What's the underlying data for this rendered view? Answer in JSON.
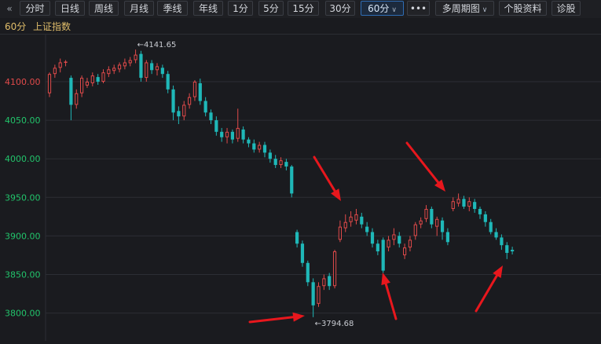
{
  "toolbar": {
    "back_icon": "double-chevron-left-icon",
    "buttons": [
      "分时",
      "日线",
      "周线",
      "月线",
      "季线",
      "年线",
      "1分",
      "5分",
      "15分",
      "30分",
      "60分",
      "•••",
      "多周期图",
      "个股资料",
      "诊股"
    ],
    "active": "60分"
  },
  "subheader": {
    "period": "60分",
    "index_name": "上证指数"
  },
  "colors": {
    "up": "#e04a4a",
    "down": "#1fb8b8",
    "grid": "#2c2e34",
    "axis_text_up": "#e04a4a",
    "axis_text_down": "#22c46b",
    "annotation_arrow": "#e8171d"
  },
  "chart_data": {
    "type": "candlestick",
    "ylim": [
      3780,
      4160
    ],
    "y_ticks": [
      3800,
      3850,
      3900,
      3950,
      4000,
      4050,
      4100
    ],
    "y_tick_labels": [
      "3800.00",
      "3850.00",
      "3900.00",
      "3950.00",
      "4000.00",
      "4050.00",
      "4100.00"
    ],
    "high_label": "4141.65",
    "low_label": "3794.68",
    "candles": [
      [
        4085,
        4110,
        4080,
        4112
      ],
      [
        4110,
        4118,
        4105,
        4122
      ],
      [
        4118,
        4125,
        4112,
        4130
      ],
      [
        4125,
        4126,
        4120,
        4128
      ],
      [
        4105,
        4070,
        4050,
        4108
      ],
      [
        4070,
        4085,
        4065,
        4090
      ],
      [
        4085,
        4105,
        4080,
        4108
      ],
      [
        4095,
        4100,
        4092,
        4105
      ],
      [
        4098,
        4108,
        4094,
        4112
      ],
      [
        4106,
        4100,
        4096,
        4110
      ],
      [
        4100,
        4112,
        4098,
        4116
      ],
      [
        4110,
        4116,
        4106,
        4120
      ],
      [
        4114,
        4118,
        4110,
        4122
      ],
      [
        4116,
        4122,
        4112,
        4125
      ],
      [
        4120,
        4125,
        4116,
        4130
      ],
      [
        4124,
        4128,
        4120,
        4132
      ],
      [
        4128,
        4135,
        4124,
        4141.65
      ],
      [
        4136,
        4105,
        4100,
        4140
      ],
      [
        4105,
        4125,
        4100,
        4128
      ],
      [
        4124,
        4115,
        4110,
        4128
      ],
      [
        4115,
        4120,
        4108,
        4124
      ],
      [
        4118,
        4110,
        4105,
        4122
      ],
      [
        4110,
        4090,
        4085,
        4114
      ],
      [
        4090,
        4060,
        4050,
        4095
      ],
      [
        4062,
        4055,
        4045,
        4068
      ],
      [
        4055,
        4070,
        4050,
        4075
      ],
      [
        4070,
        4080,
        4065,
        4085
      ],
      [
        4080,
        4100,
        4075,
        4102
      ],
      [
        4098,
        4075,
        4070,
        4104
      ],
      [
        4075,
        4060,
        4055,
        4080
      ],
      [
        4060,
        4050,
        4045,
        4064
      ],
      [
        4050,
        4035,
        4030,
        4055
      ],
      [
        4035,
        4028,
        4022,
        4040
      ],
      [
        4028,
        4035,
        4020,
        4040
      ],
      [
        4035,
        4025,
        4020,
        4038
      ],
      [
        4026,
        4040,
        4022,
        4065
      ],
      [
        4038,
        4025,
        4020,
        4042
      ],
      [
        4025,
        4020,
        4015,
        4028
      ],
      [
        4020,
        4012,
        4008,
        4025
      ],
      [
        4012,
        4018,
        4008,
        4022
      ],
      [
        4018,
        4008,
        4002,
        4022
      ],
      [
        4008,
        4000,
        3995,
        4012
      ],
      [
        4000,
        3992,
        3988,
        4005
      ],
      [
        3992,
        3998,
        3988,
        4002
      ],
      [
        3996,
        3990,
        3985,
        4000
      ],
      [
        3990,
        3955,
        3950,
        3992
      ],
      [
        3905,
        3890,
        3885,
        3908
      ],
      [
        3890,
        3865,
        3860,
        3894
      ],
      [
        3865,
        3840,
        3835,
        3868
      ],
      [
        3840,
        3810,
        3794.68,
        3845
      ],
      [
        3812,
        3835,
        3808,
        3840
      ],
      [
        3835,
        3845,
        3830,
        3850
      ],
      [
        3848,
        3835,
        3830,
        3852
      ],
      [
        3835,
        3880,
        3832,
        3882
      ],
      [
        3895,
        3912,
        3892,
        3920
      ],
      [
        3910,
        3918,
        3905,
        3928
      ],
      [
        3918,
        3925,
        3912,
        3932
      ],
      [
        3920,
        3928,
        3915,
        3935
      ],
      [
        3925,
        3915,
        3910,
        3930
      ],
      [
        3912,
        3905,
        3900,
        3918
      ],
      [
        3905,
        3890,
        3885,
        3910
      ],
      [
        3890,
        3880,
        3875,
        3895
      ],
      [
        3895,
        3855,
        3852,
        3898
      ],
      [
        3885,
        3895,
        3880,
        3900
      ],
      [
        3895,
        3902,
        3888,
        3910
      ],
      [
        3900,
        3890,
        3885,
        3905
      ],
      [
        3875,
        3885,
        3870,
        3890
      ],
      [
        3885,
        3895,
        3880,
        3900
      ],
      [
        3900,
        3915,
        3895,
        3918
      ],
      [
        3915,
        3920,
        3910,
        3924
      ],
      [
        3922,
        3935,
        3918,
        3940
      ],
      [
        3935,
        3915,
        3910,
        3938
      ],
      [
        3912,
        3922,
        3900,
        3925
      ],
      [
        3920,
        3905,
        3895,
        3924
      ],
      [
        3905,
        3892,
        3888,
        3910
      ],
      [
        3935,
        3945,
        3932,
        3950
      ],
      [
        3942,
        3948,
        3938,
        3955
      ],
      [
        3948,
        3938,
        3935,
        3952
      ],
      [
        3938,
        3945,
        3932,
        3950
      ],
      [
        3944,
        3935,
        3930,
        3948
      ],
      [
        3935,
        3928,
        3922,
        3938
      ],
      [
        3928,
        3918,
        3912,
        3932
      ],
      [
        3918,
        3905,
        3902,
        3922
      ],
      [
        3905,
        3898,
        3895,
        3910
      ],
      [
        3898,
        3888,
        3882,
        3902
      ],
      [
        3888,
        3878,
        3870,
        3892
      ],
      [
        3882,
        3880,
        3876,
        3886
      ]
    ],
    "annotations": [
      {
        "label": "down-arrow-1"
      },
      {
        "label": "up-arrow-1"
      },
      {
        "label": "down-arrow-2"
      },
      {
        "label": "up-arrow-2"
      },
      {
        "label": "right-arrow"
      }
    ]
  }
}
